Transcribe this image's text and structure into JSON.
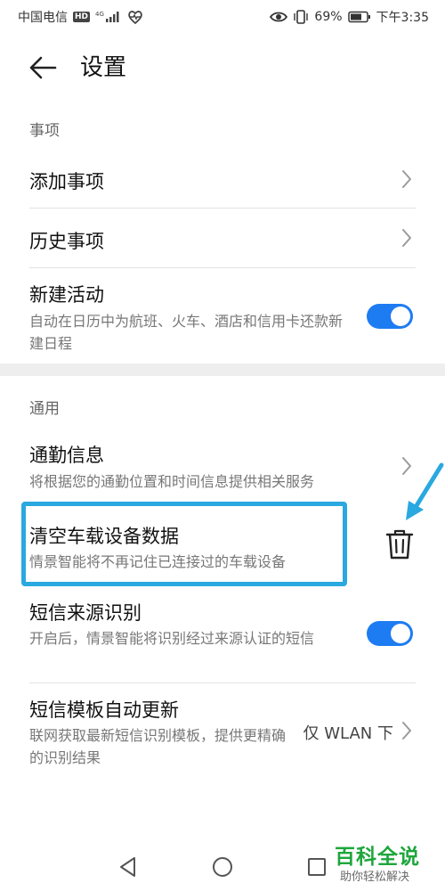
{
  "status_bar": {
    "carrier": "中国电信",
    "hd": "HD",
    "network": "4G",
    "battery": "69%",
    "time": "下午3:35"
  },
  "header": {
    "title": "设置"
  },
  "sections": {
    "events": {
      "label": "事项",
      "items": [
        {
          "title": "添加事项"
        },
        {
          "title": "历史事项"
        },
        {
          "title": "新建活动",
          "subtitle": "自动在日历中为航班、火车、酒店和信用卡还款新建日程",
          "toggle": "on"
        }
      ]
    },
    "general": {
      "label": "通用",
      "items": [
        {
          "title": "通勤信息",
          "subtitle": "将根据您的通勤位置和时间信息提供相关服务"
        },
        {
          "title": "清空车载设备数据",
          "subtitle": "情景智能将不再记住已连接过的车载设备"
        },
        {
          "title": "短信来源识别",
          "subtitle": "开启后，情景智能将识别经过来源认证的短信",
          "toggle": "on"
        },
        {
          "title": "短信模板自动更新",
          "subtitle": "联网获取最新短信识别模板，提供更精确的识别结果",
          "value": "仅 WLAN 下"
        }
      ]
    }
  },
  "watermark": {
    "title": "百科全说",
    "subtitle": "助你轻松解决"
  },
  "colors": {
    "accent": "#1e7cf2",
    "highlight": "#2aa8e0",
    "watermark": "#1ea63c"
  },
  "icons": [
    "back-arrow-icon",
    "chevron-right-icon",
    "trash-icon",
    "pointer-arrow-icon",
    "nav-back-icon",
    "nav-home-icon",
    "nav-recent-icon"
  ]
}
